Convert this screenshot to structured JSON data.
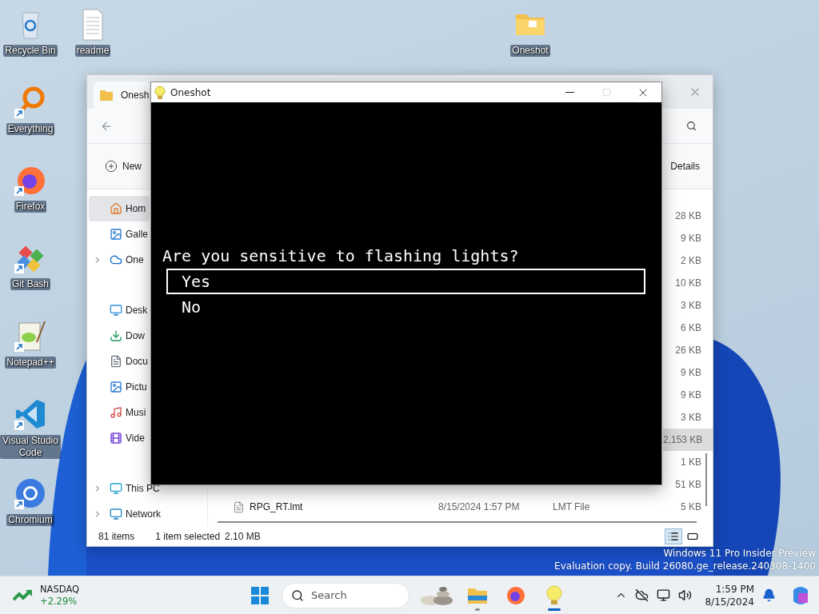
{
  "desktop_icons": [
    {
      "label": "Recycle Bin",
      "kind": "recycle",
      "shortcut": false
    },
    {
      "label": "readme",
      "kind": "document",
      "shortcut": false
    },
    {
      "label": "Oneshot",
      "kind": "folder",
      "shortcut": false
    },
    {
      "label": "Everything",
      "kind": "everything",
      "shortcut": true
    },
    {
      "label": "Firefox",
      "kind": "firefox",
      "shortcut": true
    },
    {
      "label": "Git Bash",
      "kind": "git",
      "shortcut": true
    },
    {
      "label": "Notepad++",
      "kind": "notepad",
      "shortcut": true
    },
    {
      "label": "Visual Studio Code",
      "kind": "vscode",
      "shortcut": true
    },
    {
      "label": "Chromium",
      "kind": "chromium",
      "shortcut": true
    }
  ],
  "explorer": {
    "tab_title": "Onesh",
    "new_button": "New",
    "details_button": "Details",
    "sidebar": {
      "groups": [
        [
          {
            "label": "Hom",
            "selected": true,
            "expandable": false
          },
          {
            "label": "Galle",
            "selected": false,
            "expandable": false
          },
          {
            "label": "One",
            "selected": false,
            "expandable": true
          }
        ],
        [
          {
            "label": "Desk",
            "selected": false,
            "expandable": false
          },
          {
            "label": "Dow",
            "selected": false,
            "expandable": false
          },
          {
            "label": "Docu",
            "selected": false,
            "expandable": false
          },
          {
            "label": "Pictu",
            "selected": false,
            "expandable": false
          },
          {
            "label": "Musi",
            "selected": false,
            "expandable": false
          },
          {
            "label": "Vide",
            "selected": false,
            "expandable": false
          }
        ],
        [
          {
            "label": "This PC",
            "selected": false,
            "expandable": true
          },
          {
            "label": "Network",
            "selected": false,
            "expandable": true
          }
        ]
      ]
    },
    "rows": [
      {
        "size": "28 KB",
        "selected": false
      },
      {
        "size": "9 KB",
        "selected": false
      },
      {
        "size": "2 KB",
        "selected": false
      },
      {
        "size": "10 KB",
        "selected": false
      },
      {
        "size": "3 KB",
        "selected": false
      },
      {
        "size": "6 KB",
        "selected": false
      },
      {
        "size": "26 KB",
        "selected": false
      },
      {
        "size": "9 KB",
        "selected": false
      },
      {
        "size": "9 KB",
        "selected": false
      },
      {
        "size": "3 KB",
        "selected": false
      },
      {
        "size": "2,153 KB",
        "selected": true
      },
      {
        "size": "1 KB",
        "selected": false
      },
      {
        "size": "51 KB",
        "selected": false
      },
      {
        "name": "RPG_RT.lmt",
        "date": "8/15/2024 1:57 PM",
        "type": "LMT File",
        "size": "5 KB",
        "selected": false
      }
    ],
    "status": {
      "count": "81 items",
      "selection": "1 item selected",
      "selection_size": "2.10 MB"
    },
    "views": [
      {
        "kind": "details",
        "selected": true
      },
      {
        "kind": "tiles",
        "selected": false
      }
    ]
  },
  "game_window": {
    "title": "Oneshot",
    "prompt": "Are you sensitive to flashing lights?",
    "choices": [
      {
        "label": "Yes",
        "selected": true
      },
      {
        "label": "No",
        "selected": false
      }
    ]
  },
  "watermark": [
    "Windows 11 Pro Insider Preview",
    "Evaluation copy. Build 26080.ge_release.240308-1400"
  ],
  "taskbar": {
    "widget": {
      "title": "NASDAQ",
      "change": "+2.29%"
    },
    "search": {
      "placeholder": "Search"
    },
    "apps": [
      {
        "kind": "explorer",
        "running": true,
        "active": false
      },
      {
        "kind": "firefox",
        "running": false,
        "active": false
      },
      {
        "kind": "oneshot",
        "running": true,
        "active": true
      }
    ],
    "time": "1:59 PM",
    "date": "8/15/2024"
  }
}
